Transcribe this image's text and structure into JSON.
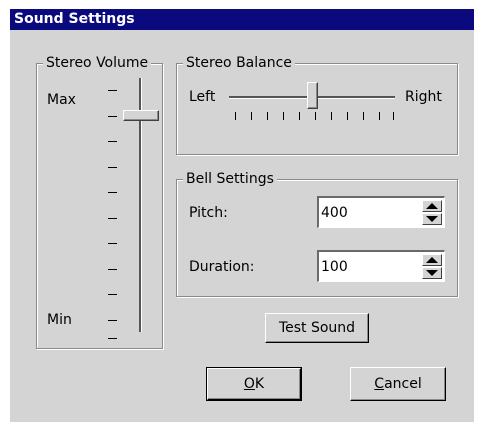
{
  "window": {
    "title": "Sound Settings"
  },
  "stereo_volume": {
    "title": "Stereo Volume",
    "max_label": "Max",
    "min_label": "Min",
    "level": 0.9
  },
  "stereo_balance": {
    "title": "Stereo Balance",
    "left_label": "Left",
    "right_label": "Right",
    "position": 0.5
  },
  "bell_settings": {
    "title": "Bell Settings",
    "pitch_label": "Pitch:",
    "pitch_value": "400",
    "duration_label": "Duration:",
    "duration_value": "100"
  },
  "buttons": {
    "test_sound": "Test Sound",
    "ok_mnemonic": "O",
    "ok_rest": "K",
    "cancel_mnemonic": "C",
    "cancel_rest": "ancel"
  },
  "colors": {
    "titlebar": "#0a0a7e",
    "dialog_bg": "#d4d4d4"
  },
  "icons": {
    "spin_up": "up-arrow-icon",
    "spin_down": "down-arrow-icon"
  }
}
